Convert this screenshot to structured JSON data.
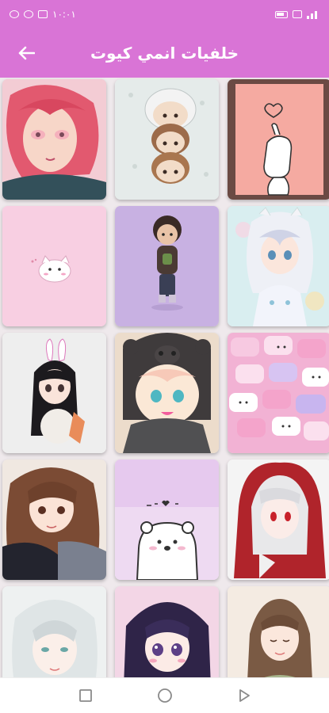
{
  "status_bar": {
    "time": "١٠:٠١"
  },
  "app_bar": {
    "title": "خلفيات انمي كيوت",
    "back_icon": "arrow-left-icon"
  },
  "theme": {
    "accent": "#d974d6"
  },
  "wallpapers": [
    {
      "name": "pink-hair-girl",
      "bg": "#f3d1d6"
    },
    {
      "name": "three-chibi-kids",
      "bg": "#e6ebea"
    },
    {
      "name": "finger-heart",
      "bg": "#f3a9a2"
    },
    {
      "name": "cat-on-pink",
      "bg": "#f7cfe1"
    },
    {
      "name": "boy-on-purple",
      "bg": "#c9b3e3"
    },
    {
      "name": "white-hair-girl",
      "bg": "#d8eef2"
    },
    {
      "name": "bunny-girl",
      "bg": "#eeeeee"
    },
    {
      "name": "bear-hood-girl",
      "bg": "#efe3d5"
    },
    {
      "name": "marshmallows",
      "bg": "#f5b3d6"
    },
    {
      "name": "brown-hair-girl",
      "bg": "#f2ebe5"
    },
    {
      "name": "polar-bear",
      "bg": "#e9d3f0"
    },
    {
      "name": "red-hood-girl",
      "bg": "#f2f2f2"
    },
    {
      "name": "silver-hair-girl",
      "bg": "#eef1f1"
    },
    {
      "name": "purple-hair-girl",
      "bg": "#f3d7e6"
    },
    {
      "name": "flower-girl",
      "bg": "#f4ebe3"
    }
  ],
  "nav_bar": {
    "recents_icon": "square-icon",
    "home_icon": "circle-icon",
    "back_icon": "triangle-back-icon"
  }
}
